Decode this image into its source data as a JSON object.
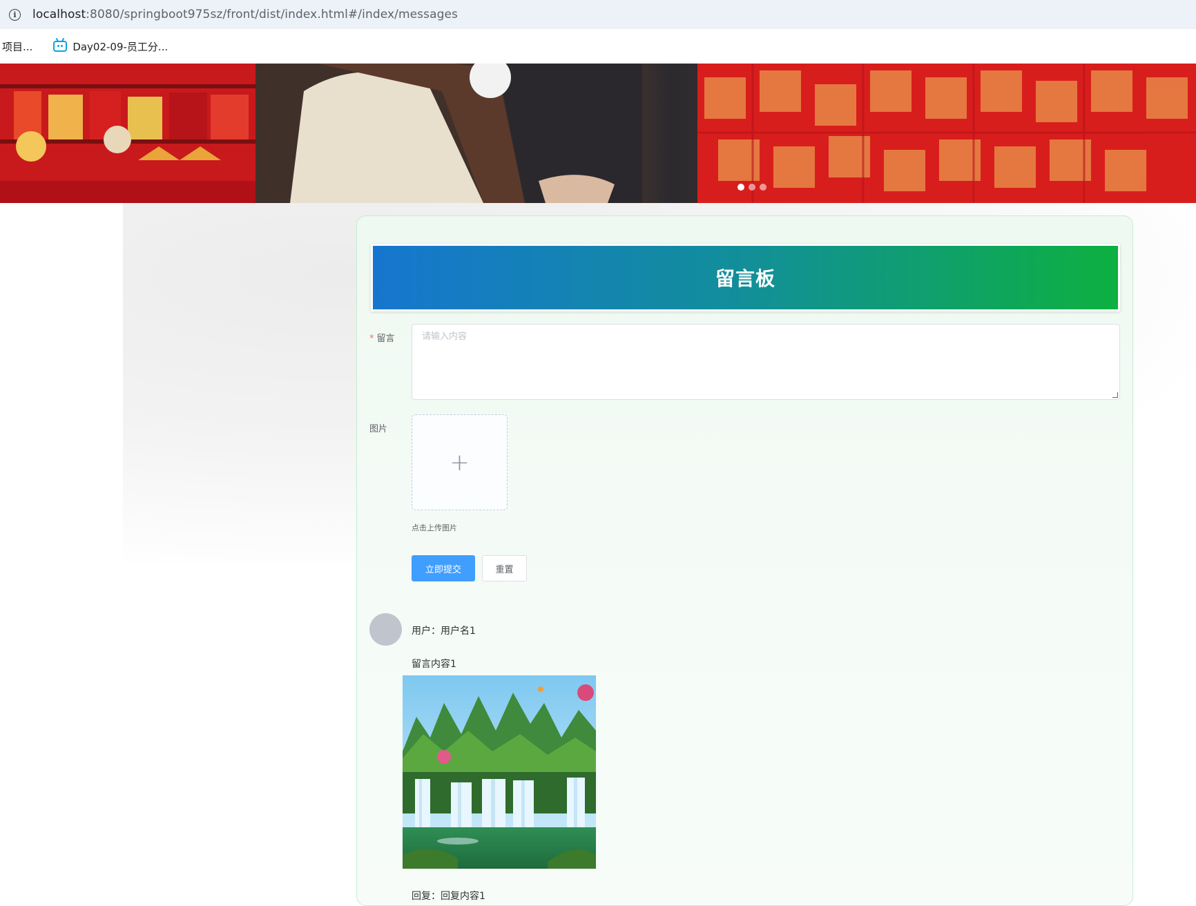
{
  "browser": {
    "url_host": "localhost",
    "url_rest": ":8080/springboot975sz/front/dist/index.html#/index/messages",
    "bookmarks": [
      {
        "label": "项目..."
      },
      {
        "label": "Day02-09-员工分..."
      }
    ]
  },
  "banner": {
    "dots": 3,
    "active_dot": 0
  },
  "board": {
    "title": "留言板"
  },
  "form": {
    "message_label": "留言",
    "required_mark": "*",
    "message_placeholder": "请输入内容",
    "image_label": "图片",
    "upload_plus": "+",
    "upload_tip": "点击上传图片",
    "submit_label": "立即提交",
    "reset_label": "重置"
  },
  "messages": [
    {
      "user": "用户：用户名1",
      "content": "留言内容1",
      "reply": "回复：回复内容1"
    }
  ],
  "colors": {
    "primary": "#409eff",
    "header_start": "#1676cf",
    "header_end": "#0db040",
    "required": "#f56c6c"
  }
}
